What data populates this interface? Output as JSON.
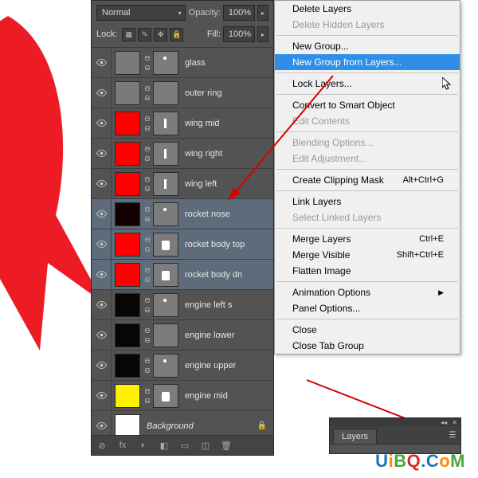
{
  "panel": {
    "blend_mode": "Normal",
    "opacity_label": "Opacity:",
    "opacity_value": "100%",
    "lock_label": "Lock:",
    "fill_label": "Fill:",
    "fill_value": "100%",
    "bottom_icons": [
      "⊘",
      "fx",
      "◐",
      "◧",
      "▭",
      "◫",
      "🗑"
    ]
  },
  "layers": [
    {
      "name": "glass",
      "thumb": "#7a7a7a",
      "mask_shape": "dot",
      "selected": false
    },
    {
      "name": "outer ring",
      "thumb": "#7a7a7a",
      "mask_shape": "none",
      "selected": false
    },
    {
      "name": "wing mid",
      "thumb": "#ff0000",
      "mask_shape": "sliver",
      "selected": false
    },
    {
      "name": "wing right",
      "thumb": "#ff0000",
      "mask_shape": "sliver",
      "selected": false
    },
    {
      "name": "wing left",
      "thumb": "#ff0000",
      "mask_shape": "sliver",
      "selected": false
    },
    {
      "name": "rocket nose",
      "thumb": "#120000",
      "mask_shape": "dot",
      "selected": true
    },
    {
      "name": "rocket body top",
      "thumb": "#ff0000",
      "mask_shape": "block",
      "selected": true
    },
    {
      "name": "rocket body dn",
      "thumb": "#ff0000",
      "mask_shape": "block",
      "selected": true
    },
    {
      "name": "engine left side",
      "thumb": "#060606",
      "mask_shape": "dot",
      "selected": false,
      "name_display": "engine left s"
    },
    {
      "name": "engine lower",
      "thumb": "#060606",
      "mask_shape": "none",
      "selected": false
    },
    {
      "name": "engine upper",
      "thumb": "#060606",
      "mask_shape": "dot",
      "selected": false
    },
    {
      "name": "engine mid",
      "thumb": "#fff200",
      "mask_shape": "block",
      "selected": false
    },
    {
      "name": "Background",
      "thumb": "#ffffff",
      "mask_shape": "bg",
      "selected": false,
      "locked": true
    }
  ],
  "menu": [
    {
      "label": "Delete Layers"
    },
    {
      "label": "Delete Hidden Layers",
      "disabled": true
    },
    {
      "sep": true
    },
    {
      "label": "New Group..."
    },
    {
      "label": "New Group from Layers...",
      "highlight": true
    },
    {
      "sep": true
    },
    {
      "label": "Lock Layers..."
    },
    {
      "sep": true
    },
    {
      "label": "Convert to Smart Object"
    },
    {
      "label": "Edit Contents",
      "disabled": true
    },
    {
      "sep": true
    },
    {
      "label": "Blending Options...",
      "disabled": true
    },
    {
      "label": "Edit Adjustment...",
      "disabled": true
    },
    {
      "sep": true
    },
    {
      "label": "Create Clipping Mask",
      "shortcut": "Alt+Ctrl+G"
    },
    {
      "sep": true
    },
    {
      "label": "Link Layers"
    },
    {
      "label": "Select Linked Layers",
      "disabled": true
    },
    {
      "sep": true
    },
    {
      "label": "Merge Layers",
      "shortcut": "Ctrl+E"
    },
    {
      "label": "Merge Visible",
      "shortcut": "Shift+Ctrl+E"
    },
    {
      "label": "Flatten Image"
    },
    {
      "sep": true
    },
    {
      "label": "Animation Options",
      "submenu": true
    },
    {
      "label": "Panel Options..."
    },
    {
      "sep": true
    },
    {
      "label": "Close"
    },
    {
      "label": "Close Tab Group"
    }
  ],
  "mini_panel": {
    "tab": "Layers"
  },
  "watermark": "UiBQ.CoM"
}
